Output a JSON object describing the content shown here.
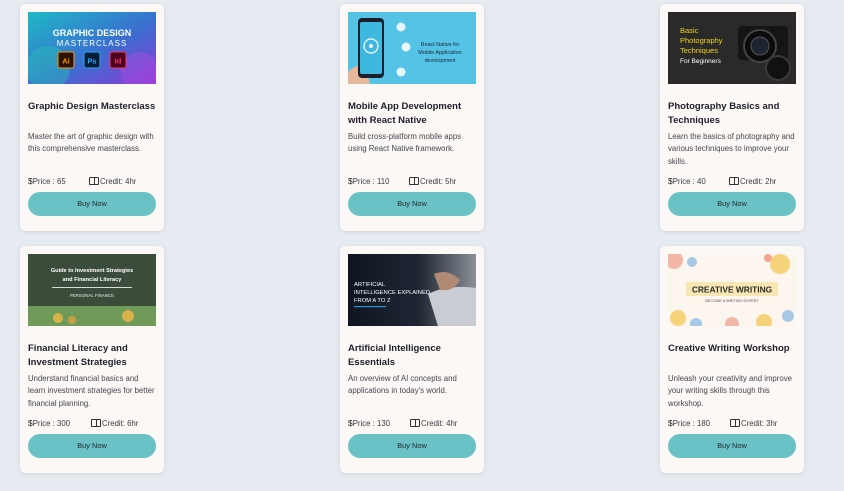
{
  "courses": [
    {
      "title": "Graphic Design Masterclass",
      "description": "Master the art of graphic design with this comprehensive masterclass.",
      "price_label": "Price : 65",
      "credit_label": "Credit: 4hr",
      "button_label": "Buy Now",
      "thumb": {
        "line1": "GRAPHIC DESIGN",
        "line2": "MASTERCLASS",
        "icons": [
          "Ai",
          "Ps",
          "Id"
        ]
      }
    },
    {
      "title": "Mobile App Development with React Native",
      "description": "Build cross-platform mobile apps using React Native framework.",
      "price_label": "Price : 110",
      "credit_label": "Credit: 5hr",
      "button_label": "Buy Now",
      "thumb": {
        "line1": "React Native for",
        "line2": "Mobile Application",
        "line3": "development"
      }
    },
    {
      "title": "Photography Basics and Techniques",
      "description": "Learn the basics of photography and various techniques to improve your skills.",
      "price_label": "Price : 40",
      "credit_label": "Credit: 2hr",
      "button_label": "Buy Now",
      "thumb": {
        "line1": "Basic",
        "line2": "Photography",
        "line3": "Techniques",
        "line4": "For Beginners"
      }
    },
    {
      "title": "Financial Literacy and Investment Strategies",
      "description": "Understand financial basics and learn investment strategies for better financial planning.",
      "price_label": "Price : 300",
      "credit_label": "Credit: 6hr",
      "button_label": "Buy Now",
      "thumb": {
        "line1": "Guide to Investment Strategies",
        "line2": "and Financial Literacy",
        "line3": "PERSONAL FINANCE"
      }
    },
    {
      "title": "Artificial Intelligence Essentials",
      "description": "An overview of AI concepts and applications in today's world.",
      "price_label": "Price : 130",
      "credit_label": "Credit: 4hr",
      "button_label": "Buy Now",
      "thumb": {
        "line1": "ARTIFICIAL",
        "line2": "INTELLIGENCE EXPLAINED",
        "line3": "FROM A TO Z"
      }
    },
    {
      "title": "Creative Writing Workshop",
      "description": "Unleash your creativity and improve your writing skills through this workshop.",
      "price_label": "Price : 180",
      "credit_label": "Credit: 3hr",
      "button_label": "Buy Now",
      "thumb": {
        "line1": "CREATIVE WRITING",
        "line2": "BECOME A WRITING EXPERT"
      }
    }
  ],
  "icons": {
    "price": "dollar-icon",
    "credit": "book-icon"
  },
  "colors": {
    "page_bg": "#e6eaf1",
    "card_bg": "#fbf8f6",
    "button": "#6ac2c6"
  }
}
